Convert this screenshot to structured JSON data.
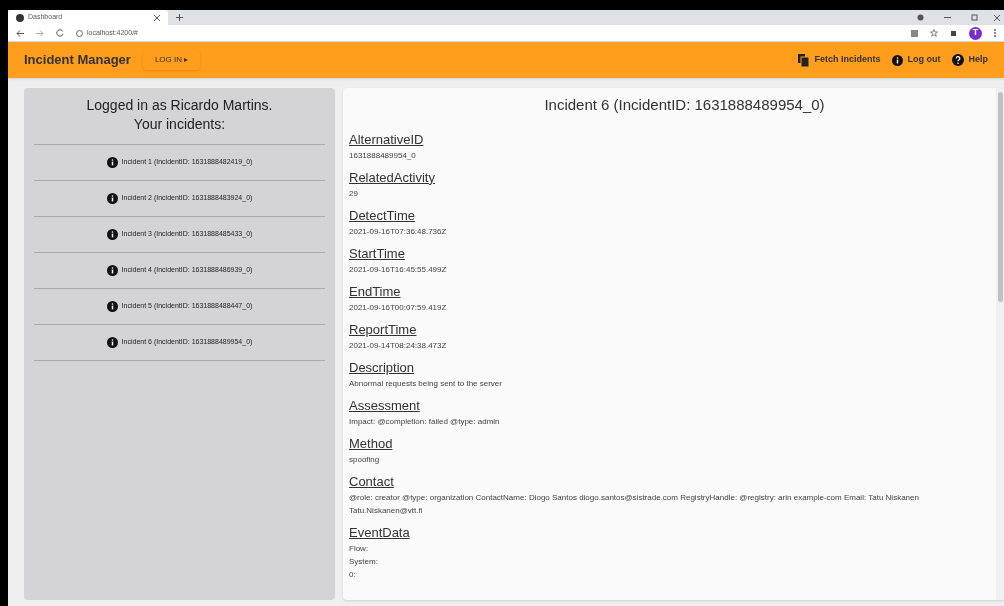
{
  "browser": {
    "tab_title": "Dashboard",
    "url": "localhost:4200/#",
    "profile_initial": "T"
  },
  "app_bar": {
    "title": "Incident Manager",
    "login_button": "LOG IN ▸",
    "actions": [
      {
        "kind": "fetch",
        "label": "Fetch Incidents"
      },
      {
        "kind": "logout",
        "label": "Log out"
      },
      {
        "kind": "help",
        "label": "Help"
      }
    ]
  },
  "sidebar": {
    "heading_line_1": "Logged in as Ricardo Martins.",
    "heading_line_2": "Your incidents:",
    "items": [
      {
        "label": "Incident 1 (IncidentID: 1631888482419_0)",
        "selected": false
      },
      {
        "label": "Incident 2 (IncidentID: 1631888483924_0)",
        "selected": false
      },
      {
        "label": "Incident 3 (IncidentID: 1631888485433_0)",
        "selected": false
      },
      {
        "label": "Incident 4 (IncidentID: 1631888486939_0)",
        "selected": false
      },
      {
        "label": "Incident 5 (IncidentID: 1631888488447_0)",
        "selected": false
      },
      {
        "label": "Incident 6 (IncidentID: 1631888489954_0)",
        "selected": false
      }
    ]
  },
  "detail": {
    "title": "Incident 6 (IncidentID: 1631888489954_0)",
    "fields": [
      {
        "label": "AlternativeID",
        "lines": [
          "1631888489954_0"
        ]
      },
      {
        "label": "RelatedActivity",
        "lines": [
          "29"
        ]
      },
      {
        "label": "DetectTime",
        "lines": [
          "2021-09-16T07:36:48.736Z"
        ]
      },
      {
        "label": "StartTime",
        "lines": [
          "2021-09-16T16:45:55.499Z"
        ]
      },
      {
        "label": "EndTime",
        "lines": [
          "2021-09-16T00:07:59.419Z"
        ]
      },
      {
        "label": "ReportTime",
        "lines": [
          "2021-09-14T08:24:38.473Z"
        ]
      },
      {
        "label": "Description",
        "lines": [
          "Abnormal requests being sent to the server"
        ]
      },
      {
        "label": "Assessment",
        "lines": [
          "Impact: @completion: failed @type: admin"
        ]
      },
      {
        "label": "Method",
        "lines": [
          "spoofing"
        ]
      },
      {
        "label": "Contact",
        "lines": [
          "@role: creator @type: organization ContactName: Diogo Santos diogo.santos@sistrade.com RegistryHandle: @registry: arin example-com Email: Tatu Niskanen Tatu.Niskanen@vtt.fi"
        ]
      },
      {
        "label": "EventData",
        "lines": [
          "Flow:",
          "System:",
          "0:"
        ]
      }
    ]
  }
}
